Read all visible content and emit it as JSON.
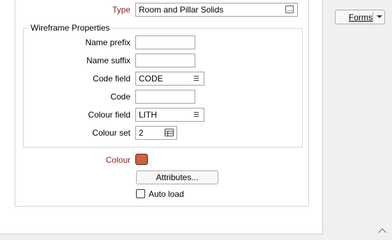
{
  "form": {
    "type_label": "Type",
    "type_value": "Room and Pillar Solids",
    "group_title": "Wireframe Properties",
    "name_prefix_label": "Name prefix",
    "name_prefix_value": "",
    "name_suffix_label": "Name suffix",
    "name_suffix_value": "",
    "code_field_label": "Code field",
    "code_field_value": "CODE",
    "code_label": "Code",
    "code_value": "",
    "colour_field_label": "Colour field",
    "colour_field_value": "LITH",
    "colour_set_label": "Colour set",
    "colour_set_value": "2",
    "colour_label": "Colour",
    "colour_swatch": "#d0603f",
    "attributes_button": "Attributes...",
    "auto_load_label": "Auto load",
    "auto_load_checked": false
  },
  "side": {
    "forms_button": "Forms"
  },
  "colors": {
    "required_label": "#8b1a1a",
    "group_border": "#d6d6d6"
  }
}
